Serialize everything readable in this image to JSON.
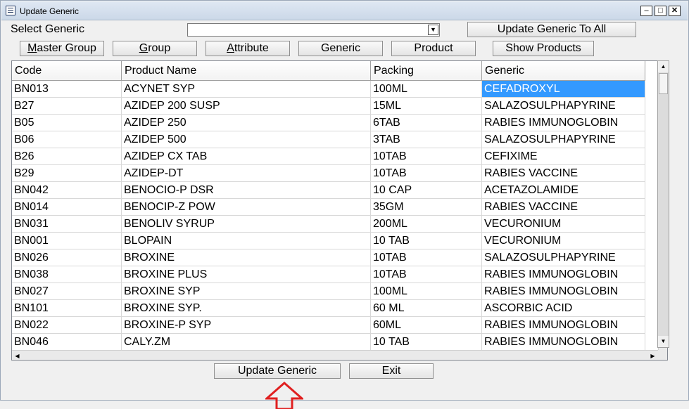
{
  "window": {
    "title": "Update Generic"
  },
  "form": {
    "select_generic_label": "Select Generic",
    "select_generic_value": "",
    "update_all_label": "Update Generic To All"
  },
  "toolbar": [
    {
      "key": "M",
      "rest": "aster Group",
      "name": "master-group-button"
    },
    {
      "key": "G",
      "rest": "roup",
      "name": "group-button"
    },
    {
      "key": "A",
      "rest": "ttribute",
      "name": "attribute-button"
    },
    {
      "key": "",
      "rest": "Generic",
      "name": "generic-button"
    },
    {
      "key": "",
      "rest": "Product",
      "name": "product-button"
    },
    {
      "key": "",
      "rest": "Show Products",
      "name": "show-products-button"
    }
  ],
  "table": {
    "columns": [
      "Code",
      "Product Name",
      "Packing",
      "Generic"
    ],
    "rows": [
      [
        "BN013",
        "ACYNET SYP",
        "100ML",
        "CEFADROXYL"
      ],
      [
        "B27",
        "AZIDEP 200 SUSP",
        "15ML",
        "SALAZOSULPHAPYRINE"
      ],
      [
        "B05",
        "AZIDEP 250",
        "6TAB",
        "RABIES IMMUNOGLOBIN"
      ],
      [
        "B06",
        "AZIDEP 500",
        "3TAB",
        "SALAZOSULPHAPYRINE"
      ],
      [
        "B26",
        "AZIDEP CX TAB",
        "10TAB",
        "CEFIXIME"
      ],
      [
        "B29",
        "AZIDEP-DT",
        "10TAB",
        "RABIES VACCINE"
      ],
      [
        "BN042",
        "BENOCIO-P DSR",
        "10 CAP",
        "ACETAZOLAMIDE"
      ],
      [
        "BN014",
        "BENOCIP-Z POW",
        "35GM",
        "RABIES VACCINE"
      ],
      [
        "BN031",
        "BENOLIV SYRUP",
        "200ML",
        "VECURONIUM"
      ],
      [
        "BN001",
        "BLOPAIN",
        "10 TAB",
        "VECURONIUM"
      ],
      [
        "BN026",
        "BROXINE",
        "10TAB",
        "SALAZOSULPHAPYRINE"
      ],
      [
        "BN038",
        "BROXINE PLUS",
        "10TAB",
        "RABIES IMMUNOGLOBIN"
      ],
      [
        "BN027",
        "BROXINE SYP",
        "100ML",
        "RABIES IMMUNOGLOBIN"
      ],
      [
        "BN101",
        "BROXINE SYP.",
        "60 ML",
        "ASCORBIC ACID"
      ],
      [
        "BN022",
        "BROXINE-P SYP",
        "60ML",
        "RABIES IMMUNOGLOBIN"
      ],
      [
        "BN046",
        "CALY.ZM",
        "10 TAB",
        "RABIES IMMUNOGLOBIN"
      ]
    ]
  },
  "footer": {
    "update_label": "Update Generic",
    "exit_label": "Exit"
  },
  "colors": {
    "selection": "#3399ff",
    "annotation": "#e02020"
  }
}
